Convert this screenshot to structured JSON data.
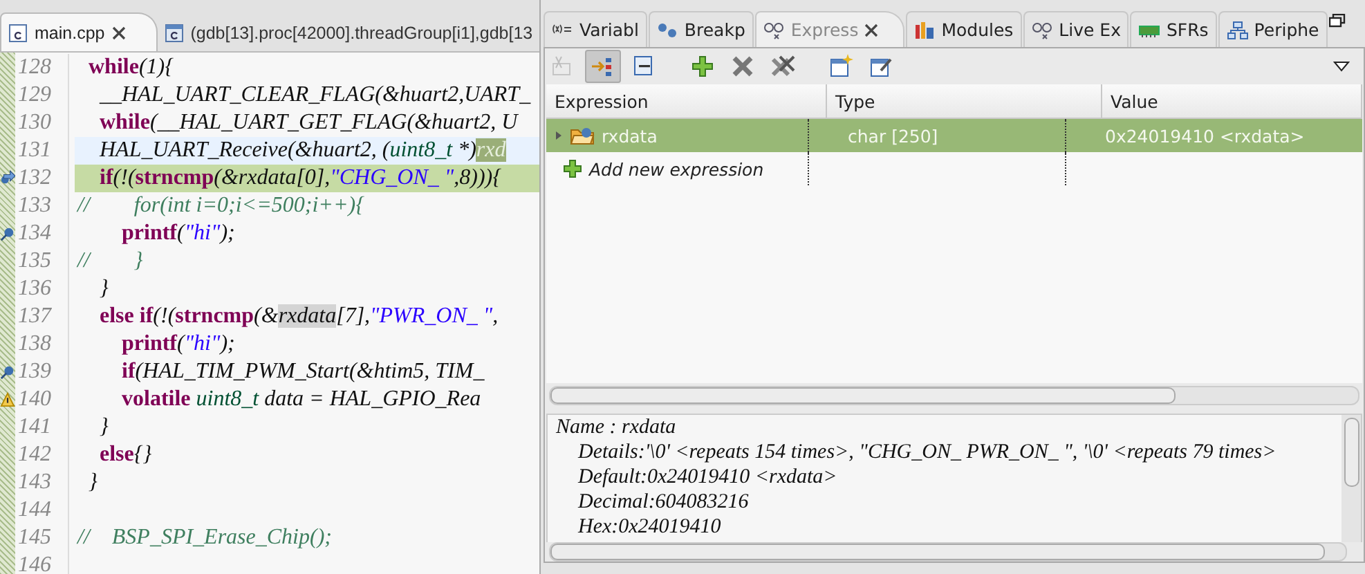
{
  "editor": {
    "tabs": [
      {
        "label": "main.cpp",
        "selected": true
      },
      {
        "label": "(gdb[13].proc[42000].threadGroup[i1],gdb[13",
        "selected": false
      }
    ],
    "lines": [
      {
        "number": "128",
        "breakpoint": false,
        "pointer": false,
        "warning": false,
        "current": false,
        "debug": false,
        "segments": [
          {
            "kind": "kw",
            "text": "  while"
          },
          {
            "kind": "plain",
            "text": "(1){"
          }
        ]
      },
      {
        "number": "129",
        "breakpoint": false,
        "pointer": false,
        "warning": false,
        "current": false,
        "debug": false,
        "segments": [
          {
            "kind": "plain",
            "text": "    __HAL_UART_CLEAR_FLAG(&huart2,UART_"
          }
        ]
      },
      {
        "number": "130",
        "breakpoint": false,
        "pointer": false,
        "warning": false,
        "current": false,
        "debug": false,
        "segments": [
          {
            "kind": "kw",
            "text": "    while"
          },
          {
            "kind": "plain",
            "text": "(__HAL_UART_GET_FLAG(&huart2, U"
          }
        ]
      },
      {
        "number": "131",
        "breakpoint": false,
        "pointer": false,
        "warning": false,
        "current": true,
        "debug": false,
        "segments": [
          {
            "kind": "plain",
            "text": "    HAL_UART_Receive(&huart2, ("
          },
          {
            "kind": "type",
            "text": "uint8_t"
          },
          {
            "kind": "plain",
            "text": " *)"
          },
          {
            "kind": "mark",
            "text": "rxd"
          }
        ]
      },
      {
        "number": "132",
        "breakpoint": true,
        "pointer": true,
        "warning": false,
        "current": false,
        "debug": true,
        "segments": [
          {
            "kind": "kw",
            "text": "    if"
          },
          {
            "kind": "plain",
            "text": "(!("
          },
          {
            "kind": "kw",
            "text": "strncmp"
          },
          {
            "kind": "plain",
            "text": "(&rxdata[0],"
          },
          {
            "kind": "str",
            "text": "\"CHG_ON_ \""
          },
          {
            "kind": "plain",
            "text": ",8))){"
          }
        ]
      },
      {
        "number": "133",
        "breakpoint": false,
        "pointer": false,
        "warning": false,
        "current": false,
        "debug": false,
        "segments": [
          {
            "kind": "comment",
            "text": "//        for(int i=0;i<=500;i++){"
          }
        ]
      },
      {
        "number": "134",
        "breakpoint": true,
        "pointer": false,
        "warning": false,
        "current": false,
        "debug": false,
        "segments": [
          {
            "kind": "kw",
            "text": "        printf"
          },
          {
            "kind": "plain",
            "text": "("
          },
          {
            "kind": "str",
            "text": "\"hi\""
          },
          {
            "kind": "plain",
            "text": ");"
          }
        ]
      },
      {
        "number": "135",
        "breakpoint": false,
        "pointer": false,
        "warning": false,
        "current": false,
        "debug": false,
        "segments": [
          {
            "kind": "comment",
            "text": "//        }"
          }
        ]
      },
      {
        "number": "136",
        "breakpoint": false,
        "pointer": false,
        "warning": false,
        "current": false,
        "debug": false,
        "segments": [
          {
            "kind": "plain",
            "text": "    }"
          }
        ]
      },
      {
        "number": "137",
        "breakpoint": false,
        "pointer": false,
        "warning": false,
        "current": false,
        "debug": false,
        "segments": [
          {
            "kind": "kw",
            "text": "    else if"
          },
          {
            "kind": "plain",
            "text": "(!("
          },
          {
            "kind": "kw",
            "text": "strncmp"
          },
          {
            "kind": "plain",
            "text": "(&"
          },
          {
            "kind": "mark",
            "text": "rxdata"
          },
          {
            "kind": "plain",
            "text": "[7],"
          },
          {
            "kind": "str",
            "text": "\"PWR_ON_ \""
          },
          {
            "kind": "plain",
            "text": ","
          }
        ]
      },
      {
        "number": "138",
        "breakpoint": false,
        "pointer": false,
        "warning": false,
        "current": false,
        "debug": false,
        "segments": [
          {
            "kind": "kw",
            "text": "        printf"
          },
          {
            "kind": "plain",
            "text": "("
          },
          {
            "kind": "str",
            "text": "\"hi\""
          },
          {
            "kind": "plain",
            "text": ");"
          }
        ]
      },
      {
        "number": "139",
        "breakpoint": true,
        "pointer": false,
        "warning": false,
        "current": false,
        "debug": false,
        "segments": [
          {
            "kind": "kw",
            "text": "        if"
          },
          {
            "kind": "plain",
            "text": "(HAL_TIM_PWM_Start(&htim5, TIM_"
          }
        ]
      },
      {
        "number": "140",
        "breakpoint": false,
        "pointer": false,
        "warning": true,
        "current": false,
        "debug": false,
        "segments": [
          {
            "kind": "kw",
            "text": "        volatile"
          },
          {
            "kind": "type",
            "text": " uint8_t"
          },
          {
            "kind": "plain",
            "text": " data = HAL_GPIO_Rea"
          }
        ]
      },
      {
        "number": "141",
        "breakpoint": false,
        "pointer": false,
        "warning": false,
        "current": false,
        "debug": false,
        "segments": [
          {
            "kind": "plain",
            "text": "    }"
          }
        ]
      },
      {
        "number": "142",
        "breakpoint": false,
        "pointer": false,
        "warning": false,
        "current": false,
        "debug": false,
        "segments": [
          {
            "kind": "kw",
            "text": "    else"
          },
          {
            "kind": "plain",
            "text": "{}"
          }
        ]
      },
      {
        "number": "143",
        "breakpoint": false,
        "pointer": false,
        "warning": false,
        "current": false,
        "debug": false,
        "segments": [
          {
            "kind": "plain",
            "text": "  }"
          }
        ]
      },
      {
        "number": "144",
        "breakpoint": false,
        "pointer": false,
        "warning": false,
        "current": false,
        "debug": false
      },
      {
        "number": "145",
        "breakpoint": false,
        "pointer": false,
        "warning": false,
        "current": false,
        "debug": false,
        "segments": [
          {
            "kind": "comment",
            "text": "//    BSP_SPI_Erase_Chip();"
          }
        ]
      },
      {
        "number": "146",
        "breakpoint": false,
        "pointer": false,
        "warning": false,
        "current": false,
        "debug": false
      }
    ]
  },
  "view": {
    "tabs": [
      {
        "label": "Variabl",
        "selected": false
      },
      {
        "label": "Breakp",
        "selected": false
      },
      {
        "label": "Express",
        "selected": true
      },
      {
        "label": "Modules",
        "selected": false
      },
      {
        "label": "Live Ex",
        "selected": false
      },
      {
        "label": "SFRs",
        "selected": false
      },
      {
        "label": "Periphe",
        "selected": false
      }
    ],
    "toolbar": [
      {
        "disabled": true,
        "pressed": false
      },
      {
        "disabled": false,
        "pressed": true
      },
      {
        "disabled": false,
        "pressed": false
      },
      {
        "disabled": false,
        "pressed": false
      },
      {
        "disabled": false,
        "pressed": false
      },
      {
        "disabled": false,
        "pressed": false
      },
      {
        "disabled": false,
        "pressed": false
      },
      {
        "disabled": false,
        "pressed": false
      }
    ],
    "table": {
      "columns": [
        "Expression",
        "Type",
        "Value"
      ],
      "rows": [
        {
          "kind": "expression",
          "expression": "rxdata",
          "type": "char [250]",
          "value": "0x24019410 <rxdata>",
          "selected": true
        },
        {
          "kind": "add",
          "expression": "Add new expression",
          "selected": false
        }
      ]
    },
    "details": [
      "Name : rxdata",
      "Details:'\\0' <repeats 154 times>, \"CHG_ON_ PWR_ON_ \", '\\0' <repeats 79 times>",
      "Default:0x24019410 <rxdata>",
      "Decimal:604083216",
      "Hex:0x24019410"
    ]
  }
}
